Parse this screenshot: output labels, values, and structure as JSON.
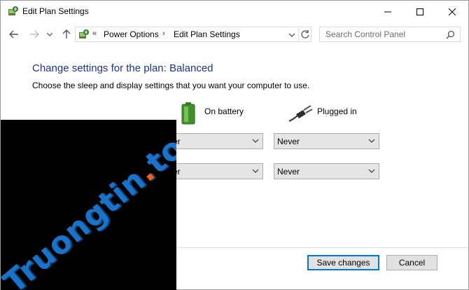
{
  "window": {
    "title": "Edit Plan Settings",
    "controls": {
      "minimize": "minimize",
      "maximize": "maximize",
      "close": "close"
    }
  },
  "address": {
    "overflow": "«",
    "crumbs": [
      "Power Options",
      "Edit Plan Settings"
    ],
    "separator": "›"
  },
  "search": {
    "placeholder": "Search Control Panel"
  },
  "main": {
    "heading": "Change settings for the plan: Balanced",
    "subtext": "Choose the sleep and display settings that you want your computer to use.",
    "columns": {
      "battery": "On battery",
      "plugged": "Plugged in"
    },
    "rows": [
      {
        "battery_value": "ver",
        "plugged_value": "Never"
      },
      {
        "battery_value": "ver",
        "plugged_value": "Never"
      }
    ]
  },
  "buttons": {
    "save": "Save changes",
    "cancel": "Cancel"
  },
  "watermark": {
    "text": "Truongtin",
    "dot": ".",
    "tld": "top"
  },
  "colors": {
    "heading": "#1e3287",
    "accent": "#0078d7",
    "watermark": "#1a73c8",
    "watermark_dot": "#e8621a"
  }
}
